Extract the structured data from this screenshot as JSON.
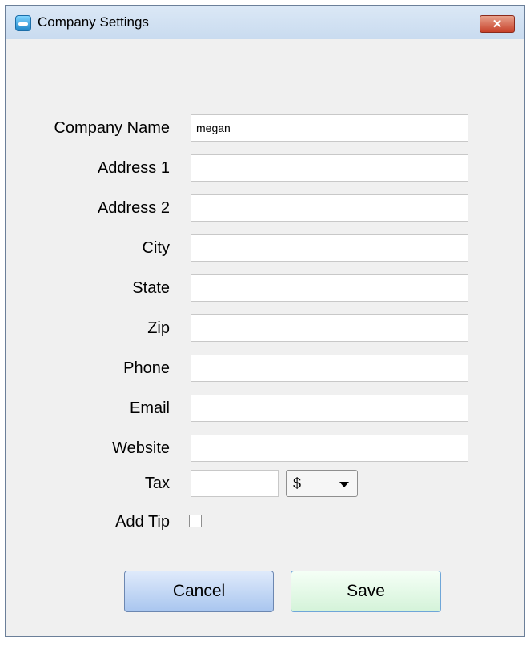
{
  "window": {
    "title": "Company Settings",
    "close_label": "✕"
  },
  "form": {
    "fields": [
      {
        "label": "Company Name",
        "value": "megan"
      },
      {
        "label": "Address 1",
        "value": ""
      },
      {
        "label": "Address 2",
        "value": ""
      },
      {
        "label": "City",
        "value": ""
      },
      {
        "label": "State",
        "value": ""
      },
      {
        "label": "Zip",
        "value": ""
      },
      {
        "label": "Phone",
        "value": ""
      },
      {
        "label": "Email",
        "value": ""
      },
      {
        "label": "Website",
        "value": ""
      }
    ],
    "tax": {
      "label": "Tax",
      "value": "",
      "unit_selected": "$"
    },
    "add_tip": {
      "label": "Add Tip",
      "checked": false
    }
  },
  "buttons": {
    "cancel_label": "Cancel",
    "save_label": "Save"
  },
  "icons": {
    "app": "app-icon",
    "close": "close-icon",
    "dropdown": "chevron-down-icon"
  }
}
